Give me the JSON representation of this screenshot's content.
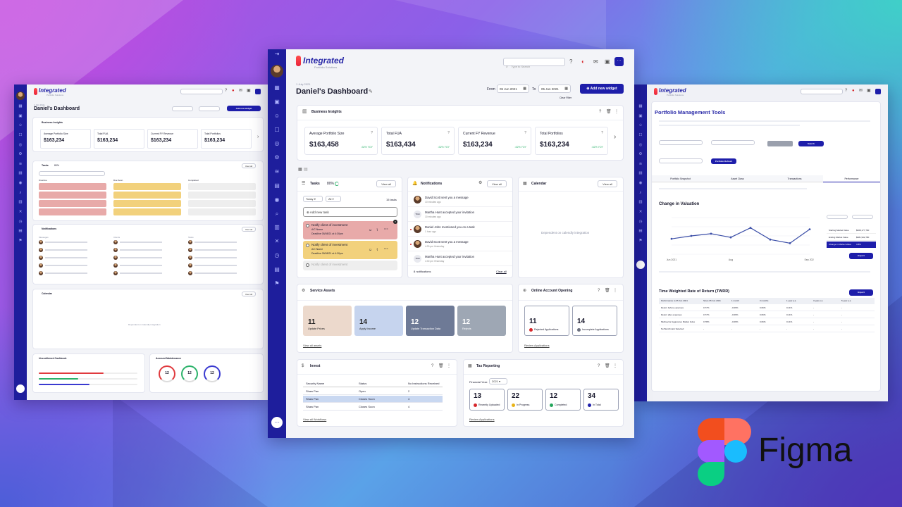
{
  "background": {
    "colors": [
      "#c44ae0",
      "#3fd0c8",
      "#4d5ed8",
      "#5a3cc8"
    ]
  },
  "brand": {
    "name": "Integrated",
    "subtitle": "Portfolio Solutions",
    "accent": "#1e1eaa",
    "logo_red": "#e9233b"
  },
  "figma": {
    "label": "Figma"
  },
  "center": {
    "date": "1 July 2021",
    "title": "Daniel's Dashboard",
    "search_placeholder": "Type to Search",
    "from_label": "From",
    "from_date": "05 Jun 2021",
    "to_label": "To",
    "to_date": "05 Jun 2021",
    "clear_filter": "Clear Filter",
    "add_widget": "Add new widget",
    "business_insights": {
      "title": "Business Insights",
      "metrics": [
        {
          "label": "Average Portfolio Size",
          "value": "$163,458",
          "change": "¹32% YOY"
        },
        {
          "label": "Total FUA",
          "value": "$163,434",
          "change": "¹32% YOY"
        },
        {
          "label": "Current FY Revenue",
          "value": "$163,234",
          "change": "¹32% YOY"
        },
        {
          "label": "Total Portfolios",
          "value": "$163,234",
          "change": "¹32% YOY"
        }
      ]
    },
    "tasks": {
      "title": "Tasks",
      "percent": "80%",
      "view_all": "View all",
      "filter_day": "Today",
      "filter_type": "All",
      "count": "15 tasks",
      "add_task": "Add new task",
      "items": [
        {
          "title": "Notify client of investment",
          "sub": "A/C Name",
          "deadline": "Deadline 05/08/21 at 4:30pm",
          "color": "#e8aaa9"
        },
        {
          "title": "Notify client of investment",
          "sub": "A/C Name",
          "deadline": "Deadline 05/08/21 at 4:30pm",
          "color": "#f2d17c"
        },
        {
          "title": "Notify client of investment",
          "sub": "",
          "deadline": "",
          "color": "#eeeeee"
        }
      ]
    },
    "notifications": {
      "title": "Notifications",
      "view_all": "View all",
      "items": [
        {
          "text": "David Scott sent you a message",
          "time": "10 minutes ago",
          "initials": ""
        },
        {
          "text": "Martha Hunt accepted your invitation",
          "time": "10 minutes ago",
          "initials": "TDH"
        },
        {
          "text": "Daniel John mentioned you on a task",
          "time": "1 hour ago",
          "initials": ""
        },
        {
          "text": "David Scott sent you a message",
          "time": "4:30 pm Yesterday",
          "initials": ""
        },
        {
          "text": "Martha Hunt accepted your invitation",
          "time": "4:30 pm Yesterday",
          "initials": "TDH"
        }
      ],
      "footer_count": "8 notifications",
      "clear_all": "Clear all"
    },
    "calendar": {
      "title": "Calendar",
      "view_all": "View all",
      "placeholder": "Dependent on calendly integration"
    },
    "service_assets": {
      "title": "Service Assets",
      "tiles": [
        {
          "value": "11",
          "label": "Update Prices",
          "color": "#ecd9cc"
        },
        {
          "value": "14",
          "label": "Apply Income",
          "color": "#c6d4ee"
        },
        {
          "value": "12",
          "label": "Update Transaction Data",
          "color": "#6e7a96"
        },
        {
          "value": "12",
          "label": "Rejects",
          "color": "#9ea7b4"
        }
      ],
      "view_all": "View all assets"
    },
    "online_account": {
      "title": "Online Account Opening",
      "tiles": [
        {
          "value": "11",
          "label": "Rejected Applications",
          "status_color": "#d6262a"
        },
        {
          "value": "14",
          "label": "Incomplete Applications",
          "status_color": "#6b6f7e"
        }
      ],
      "review": "Review Applications"
    },
    "invest": {
      "title": "Invest",
      "headers": [
        "Security Name",
        "Status",
        "No Instructions Received"
      ],
      "rows": [
        [
          "Shaw Pan",
          "Open",
          "2"
        ],
        [
          "Shaw Pan",
          "Closes Soon",
          "4"
        ],
        [
          "Shaw Pan",
          "Closes Soon",
          "4"
        ]
      ],
      "view_all": "View all Workflows"
    },
    "tax": {
      "title": "Tax Reporting",
      "fy_label": "Financial Year:",
      "fy_value": "2021",
      "tiles": [
        {
          "value": "13",
          "label": "Recently Uploaded",
          "status_color": "#d6262a"
        },
        {
          "value": "22",
          "label": "In Progress",
          "status_color": "#e8b317"
        },
        {
          "value": "12",
          "label": "Completed",
          "status_color": "#23a55a"
        },
        {
          "value": "34",
          "label": "In Total",
          "status_color": "#1e1eaa"
        }
      ],
      "review": "Review Applications"
    }
  },
  "left": {
    "date": "1 July 2021",
    "title": "Daniel's Dashboard",
    "add_widget": "Add new widget",
    "insights_title": "Business Insights",
    "metrics": [
      {
        "label": "Average Portfolio Size",
        "value": "$163,234"
      },
      {
        "label": "Total FUA",
        "value": "$163,234"
      },
      {
        "label": "Current FY Revenue",
        "value": "$163,234"
      },
      {
        "label": "Total Portfolios",
        "value": "$163,234"
      }
    ],
    "tasks_title": "Tasks",
    "tasks_percent": "80%",
    "overdue": "Overdue",
    "due_soon": "Due Soon",
    "completed": "Completed",
    "notifications_title": "Notifications",
    "messages": "Messages",
    "clients": "Clients",
    "tasks_col": "Tasks",
    "calendar_title": "Calendar",
    "calendar_placeholder": "Dependent on calendly integration",
    "unconfirmed_title": "Unconfirmed Cashbook",
    "maintenance_title": "Account Maintenance",
    "gauges": [
      "12",
      "12",
      "12"
    ],
    "view_all": "View all"
  },
  "right": {
    "title": "Portfolio Management Tools",
    "search": "Search",
    "refresh": "Portfolio Refresh",
    "tabs": [
      "Portfolio Snapshot",
      "Asset Class",
      "Transactions",
      "Performance"
    ],
    "change_title": "Change in Valuation",
    "chart_data": {
      "type": "line",
      "title": "",
      "xlabel": "",
      "ylabel": "",
      "categories": [
        "Jun 2021",
        "",
        "",
        "Aug",
        "",
        "",
        "",
        "Sep 2021"
      ],
      "values": [
        42,
        50,
        56,
        46,
        72,
        40,
        30,
        68
      ]
    },
    "summary": [
      {
        "label": "Starting Market Value",
        "value": "$968,177,790"
      },
      {
        "label": "Ending Market Value",
        "value": "$981,942,780"
      },
      {
        "label": "Change in Market Value",
        "value": "3.8%"
      }
    ],
    "export": "Export",
    "twrr_title": "Time Weighted Rate of Return (TWRR)",
    "twrr_headers": [
      "Performance to 05 Jun 2021",
      "Since 05 Jun 2021",
      "1 month",
      "3 months",
      "1 year p.a.",
      "3 year p.a.",
      "5 year p.a."
    ],
    "twrr_rows": [
      [
        "Return before expenses",
        "0.77%",
        "-0.06%",
        "0.06%",
        "0.11%",
        "-",
        "-"
      ],
      [
        "Return after expenses",
        "0.77%",
        "-0.06%",
        "0.06%",
        "0.11%",
        "-",
        "-"
      ],
      [
        "Multisector Aggressive Market Index",
        "0.78%",
        "-0.06%",
        "0.06%",
        "0.11%",
        "-",
        "-"
      ],
      [
        "No Benchmark Selected",
        "-",
        "-",
        "-",
        "-",
        "-",
        "-"
      ]
    ]
  }
}
